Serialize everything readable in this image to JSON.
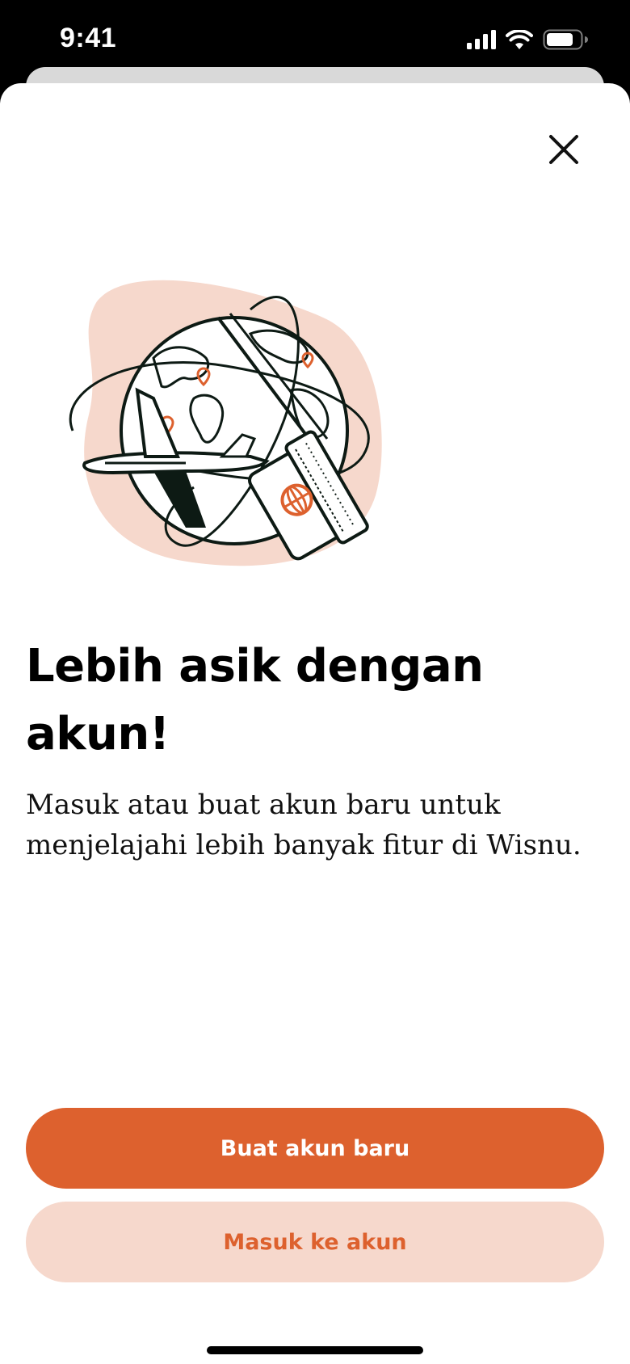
{
  "status_bar": {
    "time": "9:41",
    "icons": [
      "cellular-signal-icon",
      "wifi-icon",
      "battery-icon"
    ]
  },
  "modal": {
    "close_icon": "close-icon",
    "illustration": "globe-travel-illustration",
    "headline": "Lebih asik dengan akun!",
    "subtext": "Masuk atau buat akun baru untuk menjelajahi lebih banyak fitur di Wisnu.",
    "primary_button_label": "Buat akun baru",
    "secondary_button_label": "Masuk ke akun"
  },
  "colors": {
    "accent": "#dd612e",
    "accent_light": "#f6d8cc",
    "text": "#000000",
    "background": "#ffffff"
  }
}
